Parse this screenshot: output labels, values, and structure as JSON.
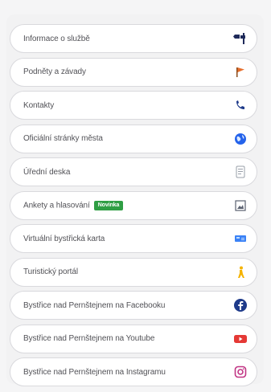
{
  "menu": {
    "items": [
      {
        "label": "Informace o službě",
        "icon": "road-sign-icon"
      },
      {
        "label": "Podněty a závady",
        "icon": "flag-icon"
      },
      {
        "label": "Kontakty",
        "icon": "phone-icon"
      },
      {
        "label": "Oficiální stránky města",
        "icon": "globe-icon"
      },
      {
        "label": "Úřední deska",
        "icon": "document-icon"
      },
      {
        "label": "Ankety a hlasování",
        "badge": "Novinka",
        "icon": "image-icon"
      },
      {
        "label": "Virtuální bystřická karta",
        "icon": "card-icon"
      },
      {
        "label": "Turistický portál",
        "icon": "hiker-icon"
      },
      {
        "label": "Bystřice nad Pernštejnem na Facebooku",
        "icon": "facebook-icon"
      },
      {
        "label": "Bystřice nad Pernštejnem na Youtube",
        "icon": "youtube-icon"
      },
      {
        "label": "Bystřice nad Pernštejnem na Instagramu",
        "icon": "instagram-icon"
      }
    ]
  },
  "colors": {
    "badge": "#2f9e44",
    "facebook": "#1e3a8a",
    "youtube": "#e53935",
    "instagram": "#c13584",
    "phone": "#1e3a8a",
    "flag": "#e76f2d"
  }
}
